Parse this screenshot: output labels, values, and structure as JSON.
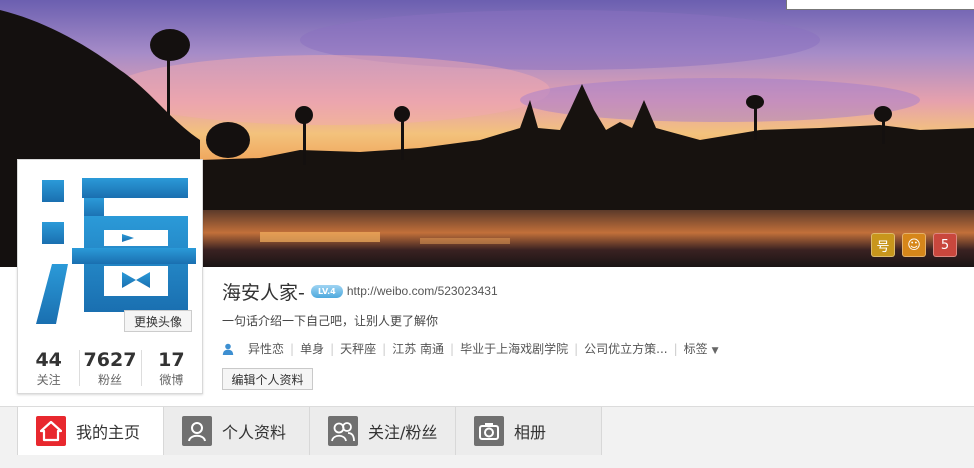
{
  "profile": {
    "name": "海安人家-",
    "level": "LV.4",
    "url": "http://weibo.com/523023431",
    "bio": "一句话介绍一下自己吧，让别人更了解你",
    "avatar_char": "海",
    "change_avatar_label": "更换头像",
    "edit_button_label": "编辑个人资料",
    "tags": [
      "异性恋",
      "单身",
      "天秤座",
      "江苏 南通",
      "毕业于上海戏剧学院",
      "公司优立方策...",
      "标签"
    ]
  },
  "stats": [
    {
      "value": "44",
      "label": "关注"
    },
    {
      "value": "7627",
      "label": "粉丝"
    },
    {
      "value": "17",
      "label": "微博"
    }
  ],
  "cover_icons": [
    {
      "glyph": "号",
      "name": "member-number-icon"
    },
    {
      "glyph": "☺",
      "name": "tiger-badge-icon"
    },
    {
      "glyph": "5",
      "name": "five-badge-icon"
    }
  ],
  "tabs": [
    {
      "label": "我的主页",
      "icon": "home-icon",
      "active": true
    },
    {
      "label": "个人资料",
      "icon": "person-icon",
      "active": false
    },
    {
      "label": "关注/粉丝",
      "icon": "people-icon",
      "active": false
    },
    {
      "label": "相册",
      "icon": "camera-icon",
      "active": false
    }
  ],
  "colors": {
    "accent_red": "#e8282e",
    "avatar_blue": "#1a7fc1",
    "level_blue": "#4ea9dd"
  }
}
